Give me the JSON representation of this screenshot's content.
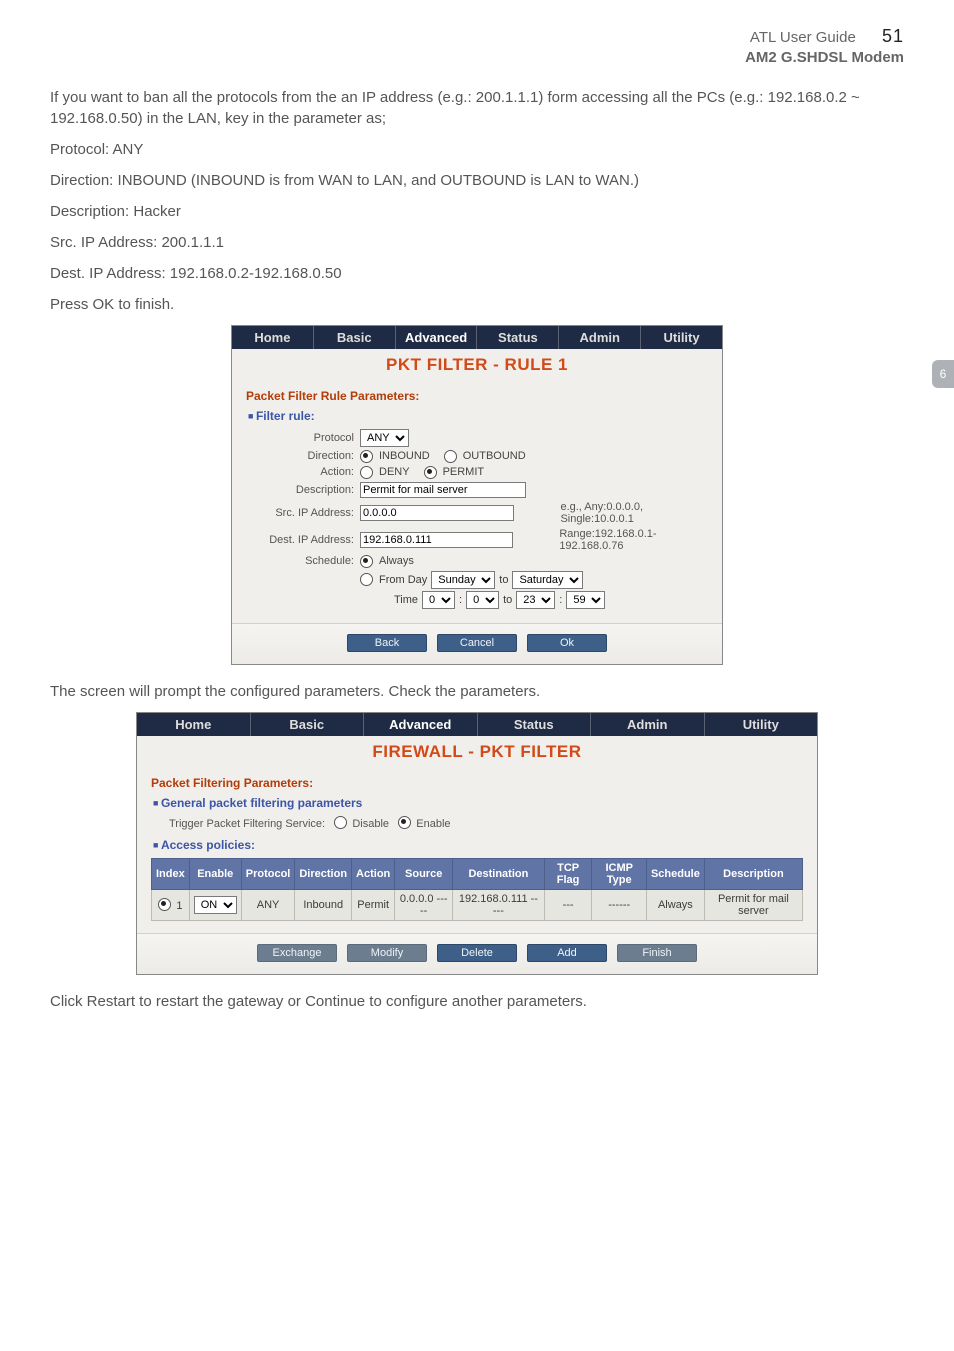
{
  "header": {
    "guide": "ATL User Guide",
    "page": "51",
    "product": "AM2 G.SHDSL Modem",
    "sideTab": "6"
  },
  "paragraphs": {
    "intro": "If you want to ban all the protocols from the an IP address (e.g.: 200.1.1.1) form accessing all the PCs (e.g.: 192.168.0.2 ~ 192.168.0.50) in the LAN, key in the parameter as;",
    "protocol": "Protocol: ANY",
    "direction": "Direction: INBOUND (INBOUND is from WAN to LAN, and OUTBOUND is LAN to WAN.)",
    "description": "Description: Hacker",
    "srcIp": "Src. IP Address: 200.1.1.1",
    "destIp": "Dest. IP Address: 192.168.0.2-192.168.0.50",
    "pressOk": "Press OK to finish.",
    "afterRule": "The screen will prompt the configured parameters. Check the parameters.",
    "restart": "Click Restart to restart the gateway or Continue to configure another parameters."
  },
  "nav": {
    "home": "Home",
    "basic": "Basic",
    "advanced": "Advanced",
    "status": "Status",
    "admin": "Admin",
    "utility": "Utility"
  },
  "rulePanel": {
    "title": "PKT FILTER - RULE 1",
    "paramsHeading": "Packet Filter Rule Parameters:",
    "filterRule": "Filter rule:",
    "labels": {
      "protocol": "Protocol",
      "direction": "Direction:",
      "action": "Action:",
      "description": "Description:",
      "srcIp": "Src. IP Address:",
      "destIp": "Dest. IP Address:",
      "schedule": "Schedule:"
    },
    "values": {
      "protocol": "ANY",
      "inbound": "INBOUND",
      "outbound": "OUTBOUND",
      "deny": "DENY",
      "permit": "PERMIT",
      "description": "Permit for mail server",
      "srcIp": "0.0.0.0",
      "srcHint": "e.g., Any:0.0.0.0, Single:10.0.0.1",
      "destIp": "192.168.0.111",
      "destHint": "Range:192.168.0.1-192.168.0.76",
      "always": "Always",
      "fromDay": "From Day",
      "sunday": "Sunday",
      "to": "to",
      "saturday": "Saturday",
      "time": "Time",
      "h1": "0",
      "m1": "0",
      "h2": "23",
      "m2": "59"
    },
    "buttons": {
      "back": "Back",
      "cancel": "Cancel",
      "ok": "Ok"
    }
  },
  "filterPanel": {
    "title": "FIREWALL - PKT FILTER",
    "paramsHeading": "Packet Filtering Parameters:",
    "generalHeading": "General packet filtering parameters",
    "triggerLabel": "Trigger Packet Filtering Service:",
    "disable": "Disable",
    "enable": "Enable",
    "accessHeading": "Access policies:",
    "tableHeaders": {
      "index": "Index",
      "enable": "Enable",
      "protocol": "Protocol",
      "direction": "Direction",
      "action": "Action",
      "source": "Source",
      "destination": "Destination",
      "tcpFlag": "TCP Flag",
      "icmpType": "ICMP Type",
      "schedule": "Schedule",
      "description": "Description"
    },
    "row": {
      "index": "1",
      "enable": "ON",
      "protocol": "ANY",
      "direction": "Inbound",
      "action": "Permit",
      "source": "0.0.0.0 -----",
      "destination": "192.168.0.111 -----",
      "tcpFlag": "---",
      "icmpType": "------",
      "schedule": "Always",
      "description": "Permit for mail server"
    },
    "buttons": {
      "exchange": "Exchange",
      "modify": "Modify",
      "delete": "Delete",
      "add": "Add",
      "finish": "Finish"
    }
  }
}
